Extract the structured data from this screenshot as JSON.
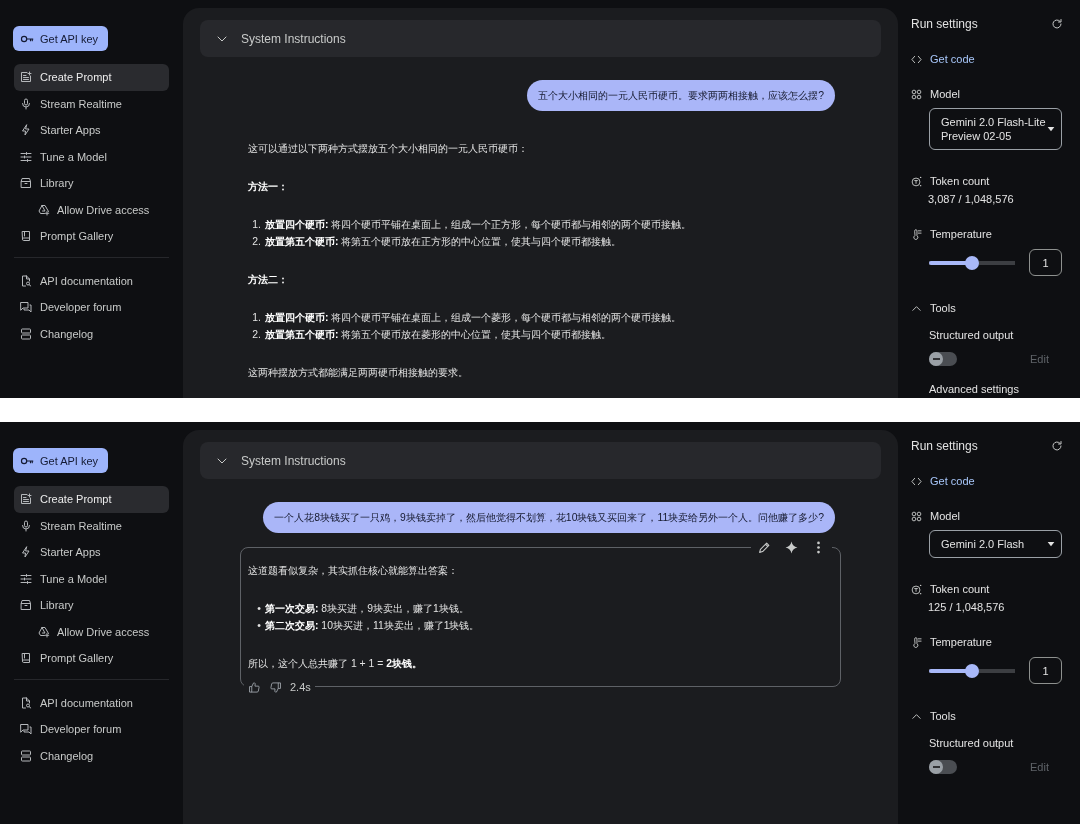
{
  "panels": [
    {
      "sidebar": {
        "api_key_button": "Get API key",
        "items": [
          {
            "label": "Create Prompt",
            "selected": true
          },
          {
            "label": "Stream Realtime",
            "selected": false
          },
          {
            "label": "Starter Apps",
            "selected": false
          },
          {
            "label": "Tune a Model",
            "selected": false
          },
          {
            "label": "Library",
            "selected": false,
            "children": [
              {
                "label": "Allow Drive access",
                "selected": false
              }
            ]
          },
          {
            "label": "Prompt Gallery",
            "selected": false
          }
        ],
        "links": [
          {
            "label": "API documentation"
          },
          {
            "label": "Developer forum"
          },
          {
            "label": "Changelog"
          }
        ]
      },
      "chat": {
        "system_instructions": {
          "label": "System Instructions",
          "expanded": false
        },
        "user_message": "五个大小相同的一元人民币硬币。要求两两相接触，应该怎么摆?",
        "response": {
          "blocks": [
            {
              "kind": "paragraph",
              "text": "这可以通过以下两种方式摆放五个大小相同的一元人民币硬币："
            },
            {
              "kind": "heading",
              "text": "方法一："
            },
            {
              "kind": "list",
              "items": [
                {
                  "marker": "1.",
                  "text": "**放置四个硬币:** 将四个硬币平铺在桌面上，组成一个正方形，每个硬币都与相邻的两个硬币接触。"
                },
                {
                  "marker": "2.",
                  "text": "**放置第五个硬币:** 将第五个硬币放在正方形的中心位置，使其与四个硬币都接触。"
                }
              ]
            },
            {
              "kind": "heading",
              "text": "方法二："
            },
            {
              "kind": "list",
              "items": [
                {
                  "marker": "1.",
                  "text": "**放置四个硬币:** 将四个硬币平铺在桌面上，组成一个菱形，每个硬币都与相邻的两个硬币接触。"
                },
                {
                  "marker": "2.",
                  "text": "**放置第五个硬币:** 将第五个硬币放在菱形的中心位置，使其与四个硬币都接触。"
                }
              ]
            },
            {
              "kind": "paragraph",
              "text": "这两种摆放方式都能满足两两硬币相接触的要求。"
            }
          ]
        }
      },
      "run_settings": {
        "title": "Run settings",
        "get_code": "Get code",
        "model": {
          "label": "Model",
          "value": "Gemini 2.0 Flash-Lite Preview 02-05"
        },
        "token_count": {
          "label": "Token count",
          "value": "3,087 / 1,048,576"
        },
        "temperature": {
          "label": "Temperature",
          "level": 0.5,
          "value": "1"
        },
        "tools": {
          "label": "Tools",
          "expanded": true,
          "structured_output": {
            "label": "Structured output",
            "on": false,
            "edit": {
              "label": "Edit",
              "disabled": true
            }
          }
        },
        "advanced_settings": "Advanced settings"
      }
    },
    {
      "sidebar": {
        "api_key_button": "Get API key",
        "items": [
          {
            "label": "Create Prompt",
            "selected": true
          },
          {
            "label": "Stream Realtime",
            "selected": false
          },
          {
            "label": "Starter Apps",
            "selected": false
          },
          {
            "label": "Tune a Model",
            "selected": false
          },
          {
            "label": "Library",
            "selected": false,
            "children": [
              {
                "label": "Allow Drive access",
                "selected": false
              }
            ]
          },
          {
            "label": "Prompt Gallery",
            "selected": false
          }
        ],
        "links": [
          {
            "label": "API documentation"
          },
          {
            "label": "Developer forum"
          },
          {
            "label": "Changelog"
          }
        ]
      },
      "chat": {
        "system_instructions": {
          "label": "System Instructions",
          "expanded": false
        },
        "user_message": "一个人花8块钱买了一只鸡，9块钱卖掉了，然后他觉得不划算，花10块钱又买回来了，11块卖给另外一个人。问他赚了多少?",
        "response": {
          "focused": true,
          "time": "2.4s",
          "blocks": [
            {
              "kind": "paragraph",
              "text": "这道题看似复杂，其实抓住核心就能算出答案："
            },
            {
              "kind": "list",
              "items": [
                {
                  "marker": "•",
                  "text": "**第一次交易:** 8块买进，9块卖出，赚了1块钱。"
                },
                {
                  "marker": "•",
                  "text": "**第二次交易:** 10块买进，11块卖出，赚了1块钱。"
                }
              ]
            },
            {
              "kind": "paragraph",
              "text": "所以，这个人总共赚了 1 + 1 = **2块钱。**"
            }
          ]
        }
      },
      "run_settings": {
        "title": "Run settings",
        "get_code": "Get code",
        "model": {
          "label": "Model",
          "value": "Gemini 2.0 Flash"
        },
        "token_count": {
          "label": "Token count",
          "value": "125 / 1,048,576"
        },
        "temperature": {
          "label": "Temperature",
          "level": 0.5,
          "value": "1"
        },
        "tools": {
          "label": "Tools",
          "expanded": true,
          "structured_output": {
            "label": "Structured output",
            "on": false,
            "edit": {
              "label": "Edit",
              "disabled": true
            }
          }
        }
      }
    }
  ]
}
